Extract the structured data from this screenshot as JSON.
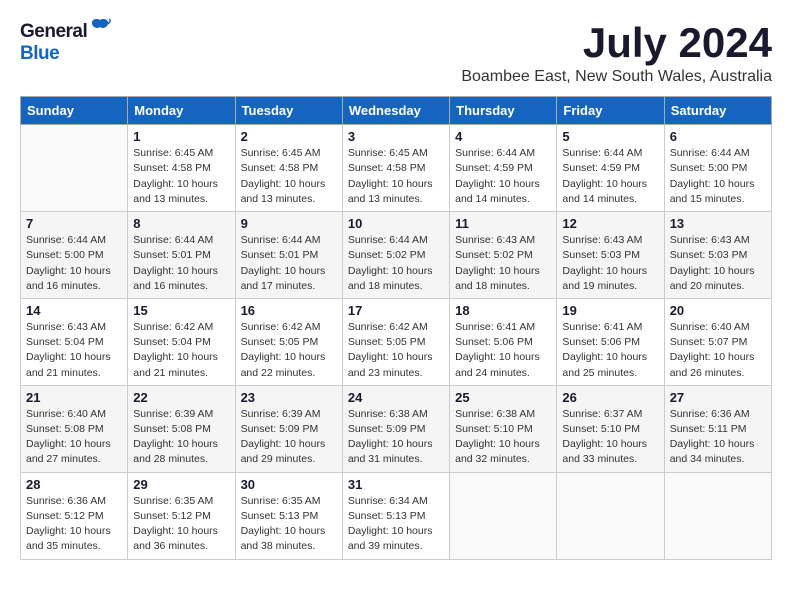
{
  "header": {
    "logo_general": "General",
    "logo_blue": "Blue",
    "month": "July 2024",
    "location": "Boambee East, New South Wales, Australia"
  },
  "days_of_week": [
    "Sunday",
    "Monday",
    "Tuesday",
    "Wednesday",
    "Thursday",
    "Friday",
    "Saturday"
  ],
  "weeks": [
    [
      {
        "day": "",
        "info": ""
      },
      {
        "day": "1",
        "info": "Sunrise: 6:45 AM\nSunset: 4:58 PM\nDaylight: 10 hours\nand 13 minutes."
      },
      {
        "day": "2",
        "info": "Sunrise: 6:45 AM\nSunset: 4:58 PM\nDaylight: 10 hours\nand 13 minutes."
      },
      {
        "day": "3",
        "info": "Sunrise: 6:45 AM\nSunset: 4:58 PM\nDaylight: 10 hours\nand 13 minutes."
      },
      {
        "day": "4",
        "info": "Sunrise: 6:44 AM\nSunset: 4:59 PM\nDaylight: 10 hours\nand 14 minutes."
      },
      {
        "day": "5",
        "info": "Sunrise: 6:44 AM\nSunset: 4:59 PM\nDaylight: 10 hours\nand 14 minutes."
      },
      {
        "day": "6",
        "info": "Sunrise: 6:44 AM\nSunset: 5:00 PM\nDaylight: 10 hours\nand 15 minutes."
      }
    ],
    [
      {
        "day": "7",
        "info": "Sunrise: 6:44 AM\nSunset: 5:00 PM\nDaylight: 10 hours\nand 16 minutes."
      },
      {
        "day": "8",
        "info": "Sunrise: 6:44 AM\nSunset: 5:01 PM\nDaylight: 10 hours\nand 16 minutes."
      },
      {
        "day": "9",
        "info": "Sunrise: 6:44 AM\nSunset: 5:01 PM\nDaylight: 10 hours\nand 17 minutes."
      },
      {
        "day": "10",
        "info": "Sunrise: 6:44 AM\nSunset: 5:02 PM\nDaylight: 10 hours\nand 18 minutes."
      },
      {
        "day": "11",
        "info": "Sunrise: 6:43 AM\nSunset: 5:02 PM\nDaylight: 10 hours\nand 18 minutes."
      },
      {
        "day": "12",
        "info": "Sunrise: 6:43 AM\nSunset: 5:03 PM\nDaylight: 10 hours\nand 19 minutes."
      },
      {
        "day": "13",
        "info": "Sunrise: 6:43 AM\nSunset: 5:03 PM\nDaylight: 10 hours\nand 20 minutes."
      }
    ],
    [
      {
        "day": "14",
        "info": "Sunrise: 6:43 AM\nSunset: 5:04 PM\nDaylight: 10 hours\nand 21 minutes."
      },
      {
        "day": "15",
        "info": "Sunrise: 6:42 AM\nSunset: 5:04 PM\nDaylight: 10 hours\nand 21 minutes."
      },
      {
        "day": "16",
        "info": "Sunrise: 6:42 AM\nSunset: 5:05 PM\nDaylight: 10 hours\nand 22 minutes."
      },
      {
        "day": "17",
        "info": "Sunrise: 6:42 AM\nSunset: 5:05 PM\nDaylight: 10 hours\nand 23 minutes."
      },
      {
        "day": "18",
        "info": "Sunrise: 6:41 AM\nSunset: 5:06 PM\nDaylight: 10 hours\nand 24 minutes."
      },
      {
        "day": "19",
        "info": "Sunrise: 6:41 AM\nSunset: 5:06 PM\nDaylight: 10 hours\nand 25 minutes."
      },
      {
        "day": "20",
        "info": "Sunrise: 6:40 AM\nSunset: 5:07 PM\nDaylight: 10 hours\nand 26 minutes."
      }
    ],
    [
      {
        "day": "21",
        "info": "Sunrise: 6:40 AM\nSunset: 5:08 PM\nDaylight: 10 hours\nand 27 minutes."
      },
      {
        "day": "22",
        "info": "Sunrise: 6:39 AM\nSunset: 5:08 PM\nDaylight: 10 hours\nand 28 minutes."
      },
      {
        "day": "23",
        "info": "Sunrise: 6:39 AM\nSunset: 5:09 PM\nDaylight: 10 hours\nand 29 minutes."
      },
      {
        "day": "24",
        "info": "Sunrise: 6:38 AM\nSunset: 5:09 PM\nDaylight: 10 hours\nand 31 minutes."
      },
      {
        "day": "25",
        "info": "Sunrise: 6:38 AM\nSunset: 5:10 PM\nDaylight: 10 hours\nand 32 minutes."
      },
      {
        "day": "26",
        "info": "Sunrise: 6:37 AM\nSunset: 5:10 PM\nDaylight: 10 hours\nand 33 minutes."
      },
      {
        "day": "27",
        "info": "Sunrise: 6:36 AM\nSunset: 5:11 PM\nDaylight: 10 hours\nand 34 minutes."
      }
    ],
    [
      {
        "day": "28",
        "info": "Sunrise: 6:36 AM\nSunset: 5:12 PM\nDaylight: 10 hours\nand 35 minutes."
      },
      {
        "day": "29",
        "info": "Sunrise: 6:35 AM\nSunset: 5:12 PM\nDaylight: 10 hours\nand 36 minutes."
      },
      {
        "day": "30",
        "info": "Sunrise: 6:35 AM\nSunset: 5:13 PM\nDaylight: 10 hours\nand 38 minutes."
      },
      {
        "day": "31",
        "info": "Sunrise: 6:34 AM\nSunset: 5:13 PM\nDaylight: 10 hours\nand 39 minutes."
      },
      {
        "day": "",
        "info": ""
      },
      {
        "day": "",
        "info": ""
      },
      {
        "day": "",
        "info": ""
      }
    ]
  ]
}
